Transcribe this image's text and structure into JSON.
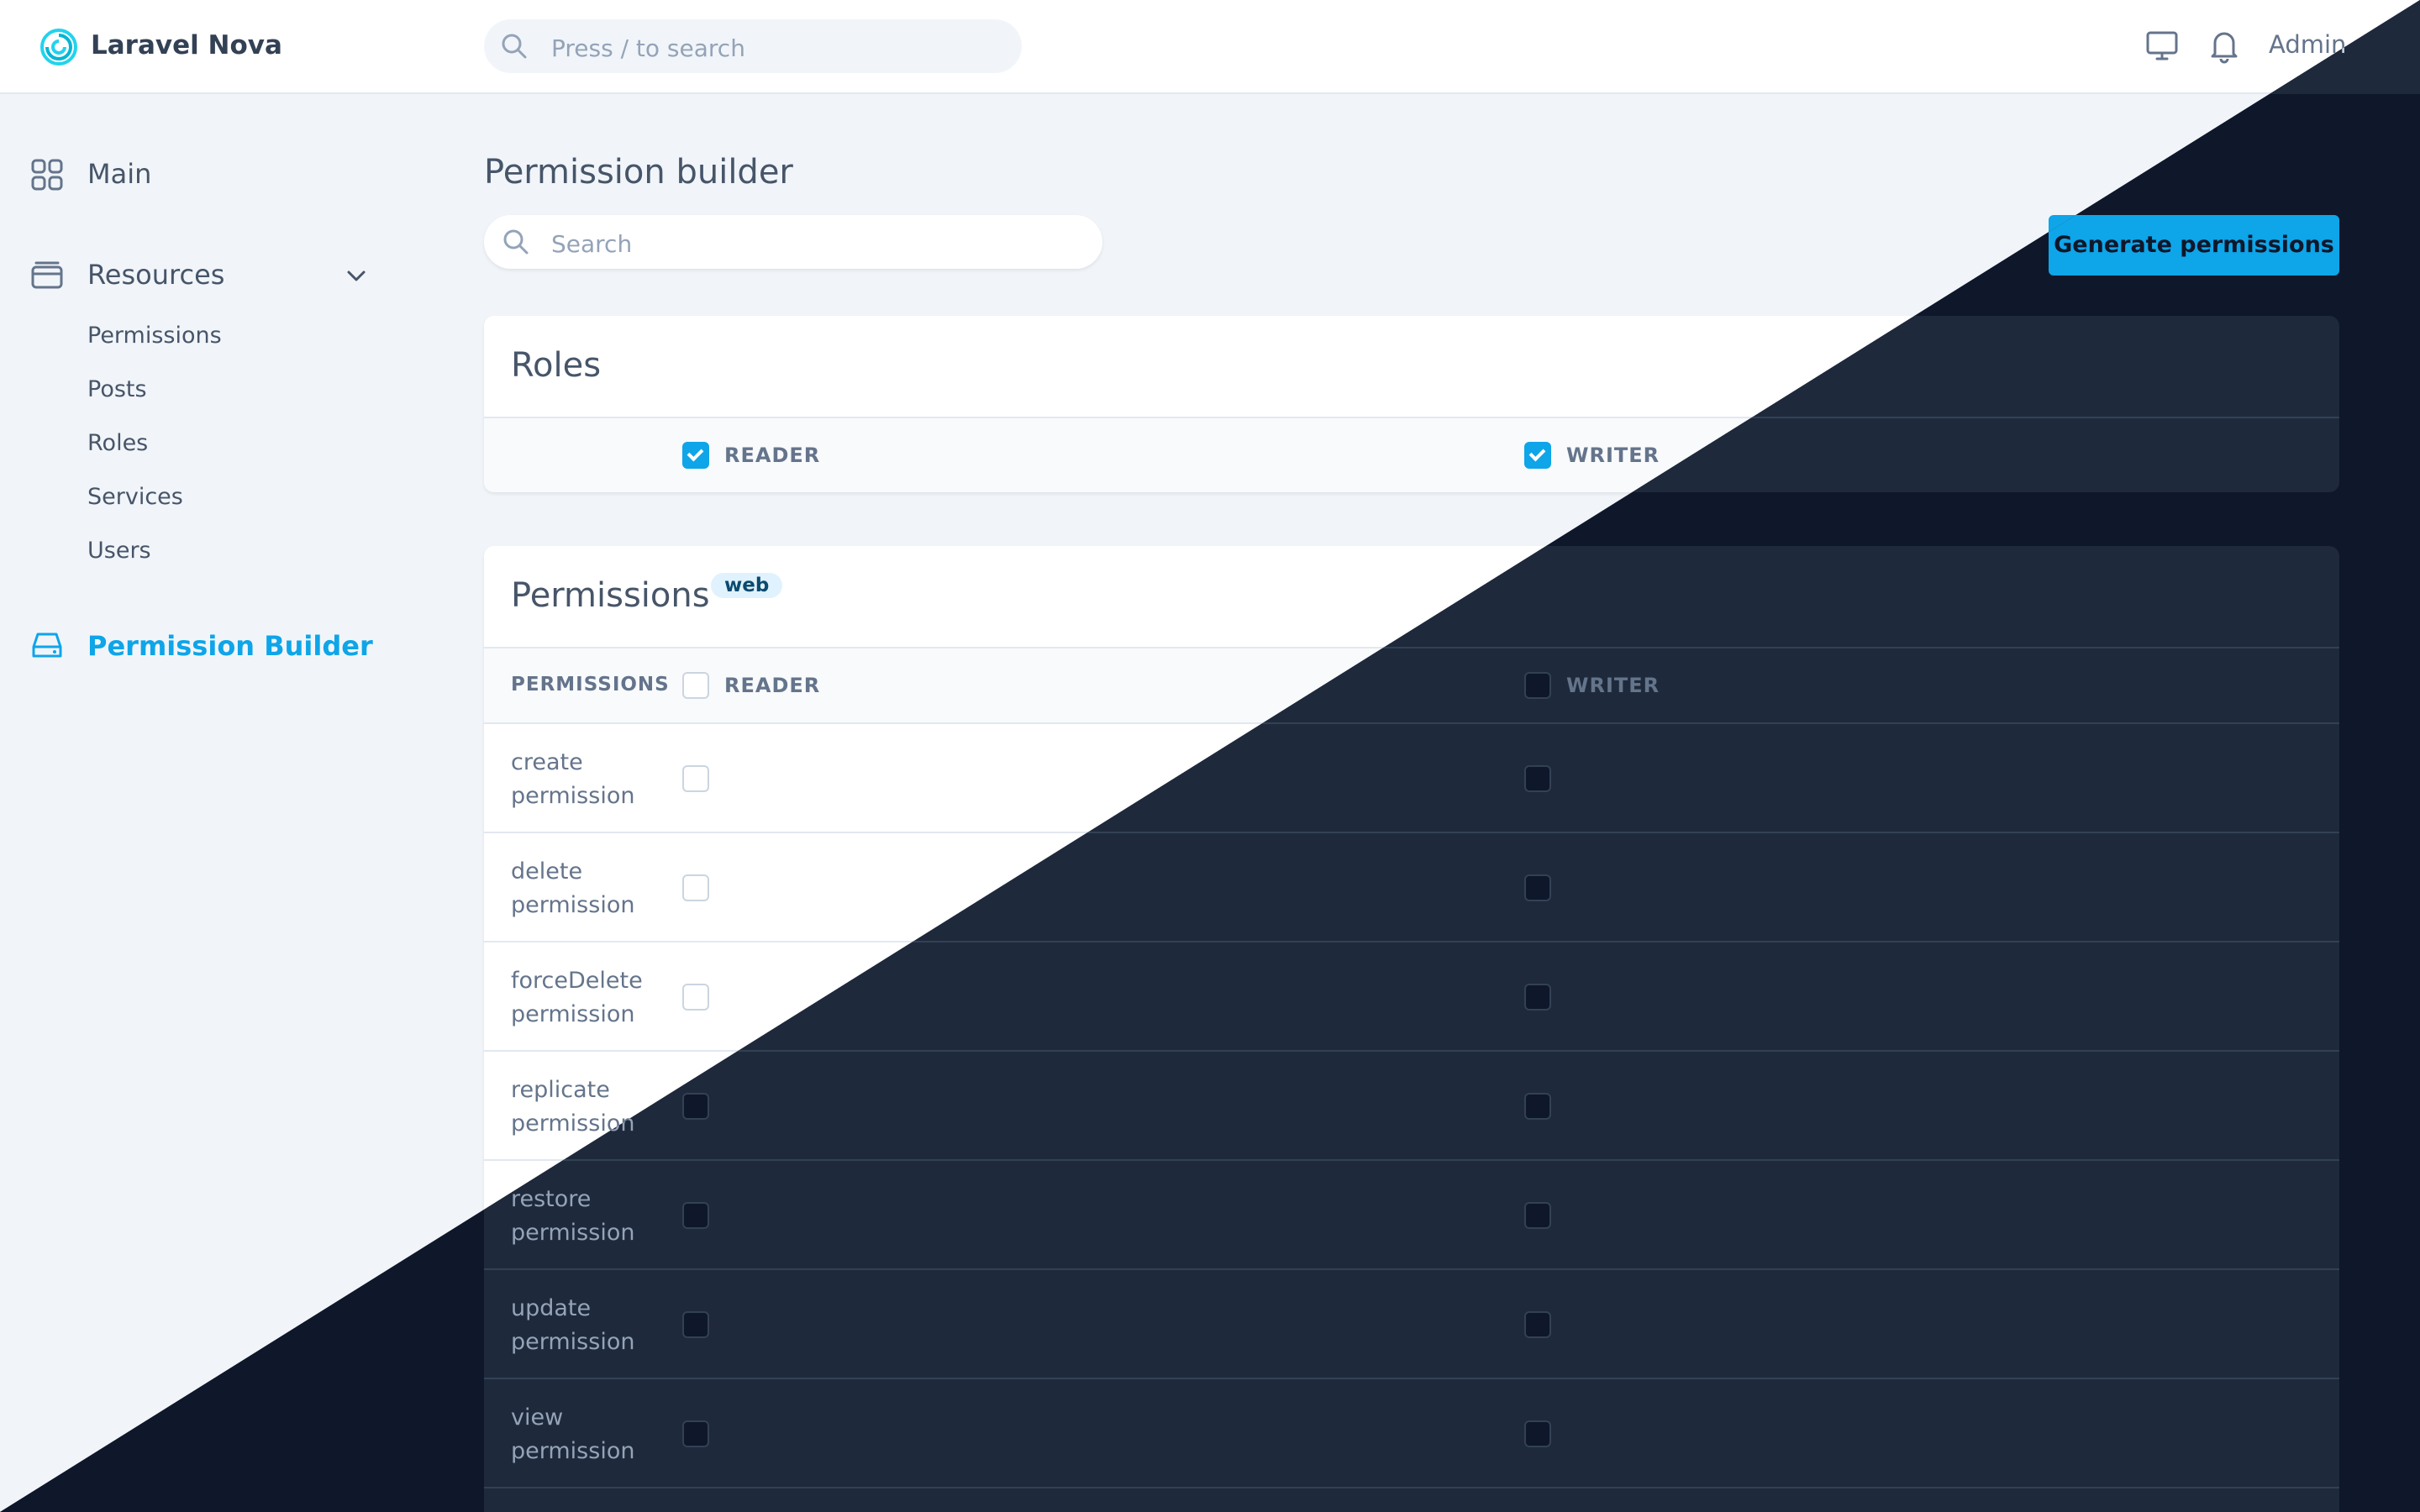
{
  "app": {
    "brand": "Laravel Nova",
    "search_placeholder": "Press / to search",
    "user_name": "Admin"
  },
  "sidebar": {
    "main_label": "Main",
    "resources_label": "Resources",
    "resources_items": [
      "Permissions",
      "Posts",
      "Roles",
      "Services",
      "Users"
    ],
    "permission_builder_label": "Permission Builder"
  },
  "page": {
    "title": "Permission builder",
    "search_placeholder": "Search",
    "generate_button": "Generate permissions"
  },
  "roles_card": {
    "title": "Roles",
    "roles": [
      {
        "name": "READER",
        "checked": true
      },
      {
        "name": "WRITER",
        "checked": true
      }
    ]
  },
  "permissions_card": {
    "title": "Permissions",
    "guard_badge": "web",
    "column_header": "PERMISSIONS",
    "role_columns": [
      "READER",
      "WRITER"
    ],
    "rows": [
      {
        "label": "create permission",
        "reader": false,
        "writer": false
      },
      {
        "label": "delete permission",
        "reader": false,
        "writer": false
      },
      {
        "label": "forceDelete permission",
        "reader": false,
        "writer": false
      },
      {
        "label": "replicate permission",
        "reader": false,
        "writer": false
      },
      {
        "label": "restore permission",
        "reader": false,
        "writer": false
      },
      {
        "label": "update permission",
        "reader": false,
        "writer": false
      },
      {
        "label": "view permission",
        "reader": false,
        "writer": false
      }
    ]
  },
  "colors": {
    "accent": "#0ea5e9",
    "light_background": "#f1f5f9",
    "dark_background": "#0f172a",
    "dark_card": "#1e293b"
  }
}
